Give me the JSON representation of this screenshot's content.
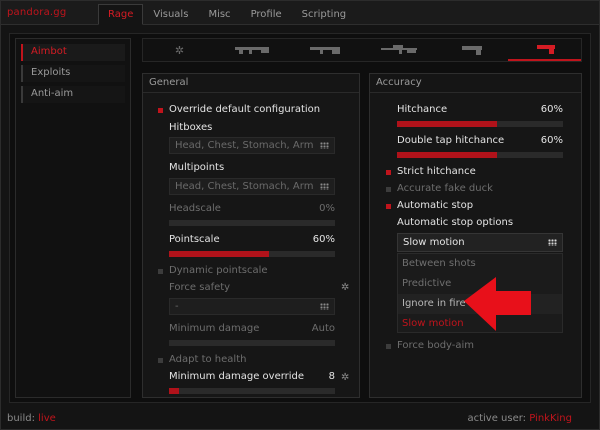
{
  "app": {
    "logo": "pandora.gg"
  },
  "tabs": [
    {
      "label": "Rage",
      "active": true
    },
    {
      "label": "Visuals"
    },
    {
      "label": "Misc"
    },
    {
      "label": "Profile"
    },
    {
      "label": "Scripting"
    }
  ],
  "sidebar": {
    "items": [
      {
        "label": "Aimbot",
        "active": true
      },
      {
        "label": "Exploits"
      },
      {
        "label": "Anti-aim"
      }
    ]
  },
  "weapons": [
    {
      "icon": "gear-icon"
    },
    {
      "icon": "rifle-icon"
    },
    {
      "icon": "smg-icon"
    },
    {
      "icon": "sniper-icon"
    },
    {
      "icon": "revolver-icon"
    },
    {
      "icon": "pistol-icon",
      "active": true
    }
  ],
  "general": {
    "title": "General",
    "override_label": "Override default configuration",
    "hitboxes_label": "Hitboxes",
    "hitboxes_value": "Head, Chest, Stomach, Arm",
    "multipoints_label": "Multipoints",
    "multipoints_value": "Head, Chest, Stomach, Arm",
    "headscale_label": "Headscale",
    "headscale_value": "0%",
    "headscale_level": 0,
    "pointscale_label": "Pointscale",
    "pointscale_value": "60%",
    "pointscale_level": 0.6,
    "dynamic_pointscale_label": "Dynamic pointscale",
    "force_safety_label": "Force safety",
    "force_safety_value": "-",
    "min_damage_label": "Minimum damage",
    "min_damage_value": "Auto",
    "min_damage_level": 0,
    "adapt_health_label": "Adapt to health",
    "min_damage_override_label": "Minimum damage override",
    "min_damage_override_value": "8",
    "min_damage_override_level": 0.06
  },
  "accuracy": {
    "title": "Accuracy",
    "hitchance_label": "Hitchance",
    "hitchance_value": "60%",
    "hitchance_level": 0.6,
    "dt_hitchance_label": "Double tap hitchance",
    "dt_hitchance_value": "60%",
    "dt_hitchance_level": 0.6,
    "strict_hitchance_label": "Strict hitchance",
    "accurate_fake_duck_label": "Accurate fake duck",
    "auto_stop_label": "Automatic stop",
    "auto_stop_options_label": "Automatic stop options",
    "auto_stop_selected": "Slow motion",
    "options": [
      "Between shots",
      "Predictive",
      "Ignore in fire",
      "Slow motion"
    ],
    "force_body_aim_label": "Force body-aim"
  },
  "footer": {
    "build_label": "build:",
    "build_value": "live",
    "user_label": "active user:",
    "user_value": "PinkKing"
  },
  "colors": {
    "accent": "#c0141c",
    "background": "#141414",
    "annotation_arrow": "#e8101a"
  }
}
